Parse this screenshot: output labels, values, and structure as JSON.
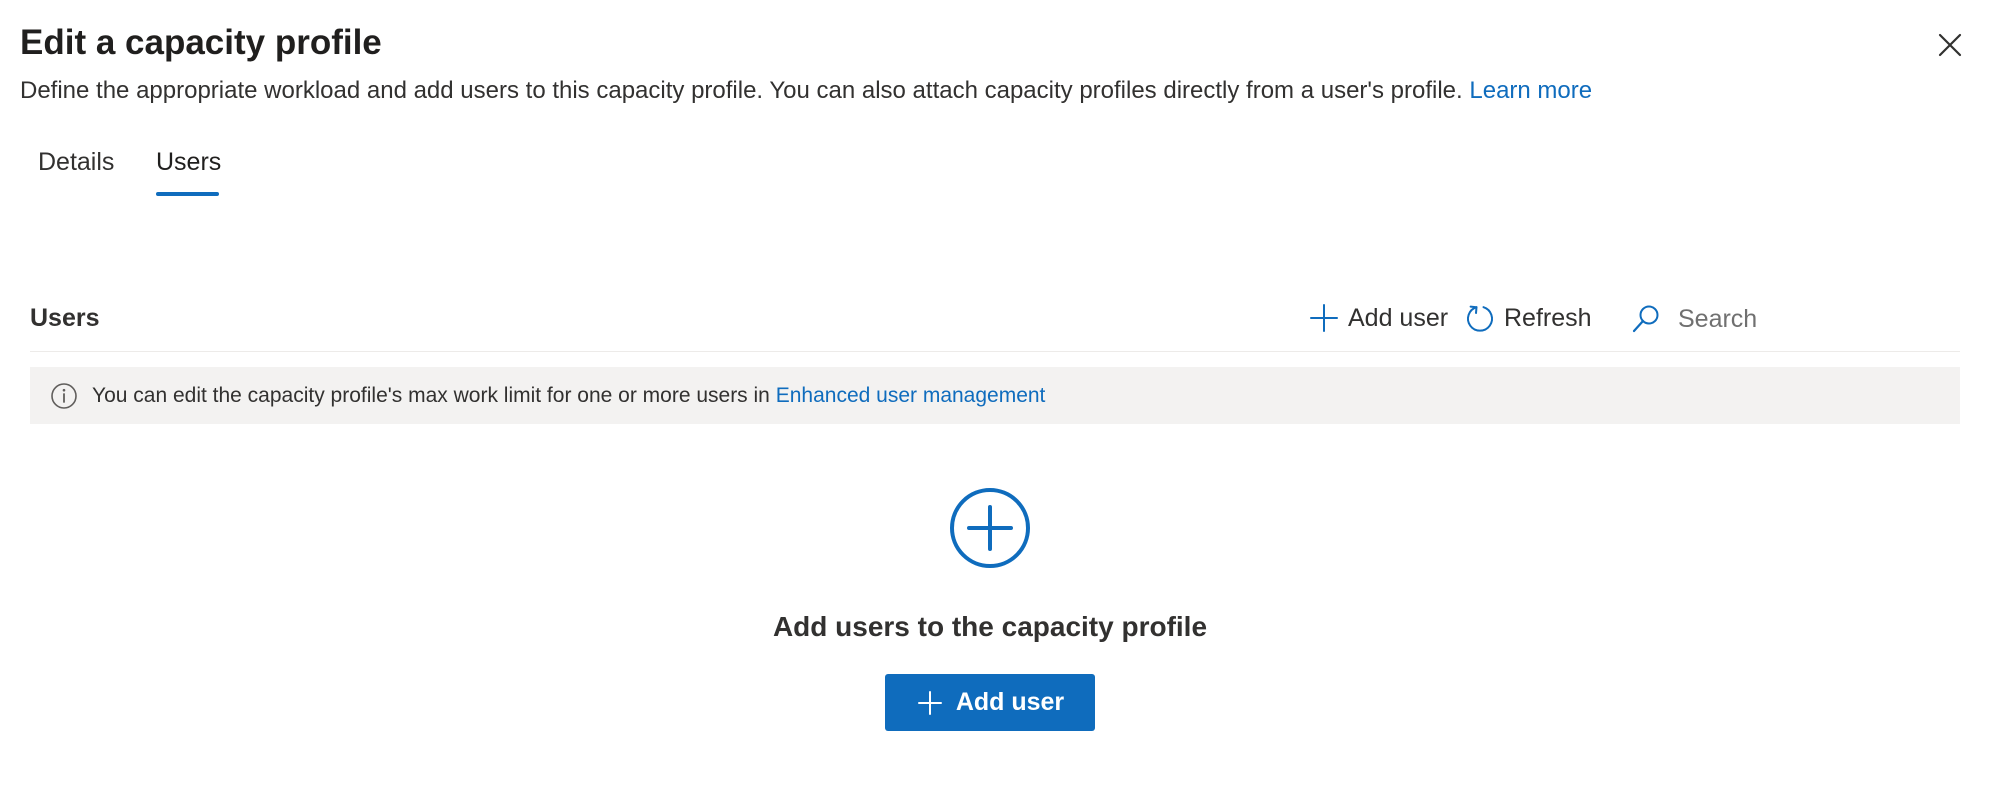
{
  "header": {
    "title": "Edit a capacity profile",
    "description": "Define the appropriate workload and add users to this capacity profile. You can also attach capacity profiles directly from a user's profile.",
    "learn_more": "Learn more",
    "close_icon": "close-icon"
  },
  "tabs": [
    {
      "label": "Details",
      "active": false
    },
    {
      "label": "Users",
      "active": true
    }
  ],
  "users_section": {
    "title": "Users",
    "toolbar": {
      "add_user_label": "Add user",
      "refresh_label": "Refresh",
      "search_placeholder": "Search",
      "search_value": ""
    },
    "info": {
      "text": "You can edit the capacity profile's max work limit for one or more users in",
      "link": "Enhanced user management",
      "icon": "info-icon"
    },
    "empty_state": {
      "icon": "add-circle-icon",
      "title": "Add users to the capacity profile",
      "button_label": "Add user"
    }
  },
  "colors": {
    "accent": "#0f6cbd",
    "info_background": "#f3f2f1",
    "text": "#323130"
  }
}
